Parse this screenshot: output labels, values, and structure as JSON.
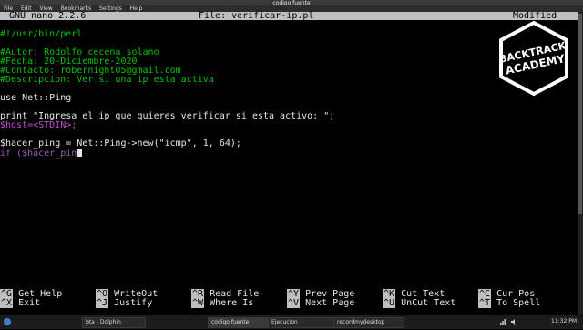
{
  "window": {
    "title": "codigo fuente"
  },
  "menu": [
    "File",
    "Edit",
    "View",
    "Bookmarks",
    "Settings",
    "Help"
  ],
  "nano": {
    "version": "GNU nano 2.2.6",
    "file": "File: verificar-ip.pl",
    "status": "Modified"
  },
  "code": [
    "#!/usr/bin/perl",
    "#Autor: Rodolfo cecena solano",
    "#Fecha: 20-Diciembre-2020",
    "#Contacto: robernight05@gmail.com",
    "#Descripcion: Ver si una ip esta activa",
    "use Net::Ping",
    "print \"Ingresa el ip que quieres verificar si esta activo: \";",
    "$host=<STDIN>;",
    "$hacer_ping = Net::Ping->new(\"icmp\", 1, 64);",
    "if ($hacer_pin"
  ],
  "logo": {
    "line1": "BACKTRACK",
    "line2": "ACADEMY"
  },
  "shortcuts": [
    {
      "key": "^G",
      "label": "Get Help"
    },
    {
      "key": "^O",
      "label": "WriteOut"
    },
    {
      "key": "^R",
      "label": "Read File"
    },
    {
      "key": "^Y",
      "label": "Prev Page"
    },
    {
      "key": "^K",
      "label": "Cut Text"
    },
    {
      "key": "^C",
      "label": "Cur Pos"
    },
    {
      "key": "^X",
      "label": "Exit"
    },
    {
      "key": "^J",
      "label": "Justify"
    },
    {
      "key": "^W",
      "label": "Where Is"
    },
    {
      "key": "^V",
      "label": "Next Page"
    },
    {
      "key": "^U",
      "label": "UnCut Text"
    },
    {
      "key": "^T",
      "label": "To Spell"
    }
  ],
  "taskbar": {
    "items": [
      "bta - Dolphin",
      "codigo fuente",
      "Ejecucion",
      "recordmydesktop"
    ],
    "clock": "11:32 PM"
  }
}
